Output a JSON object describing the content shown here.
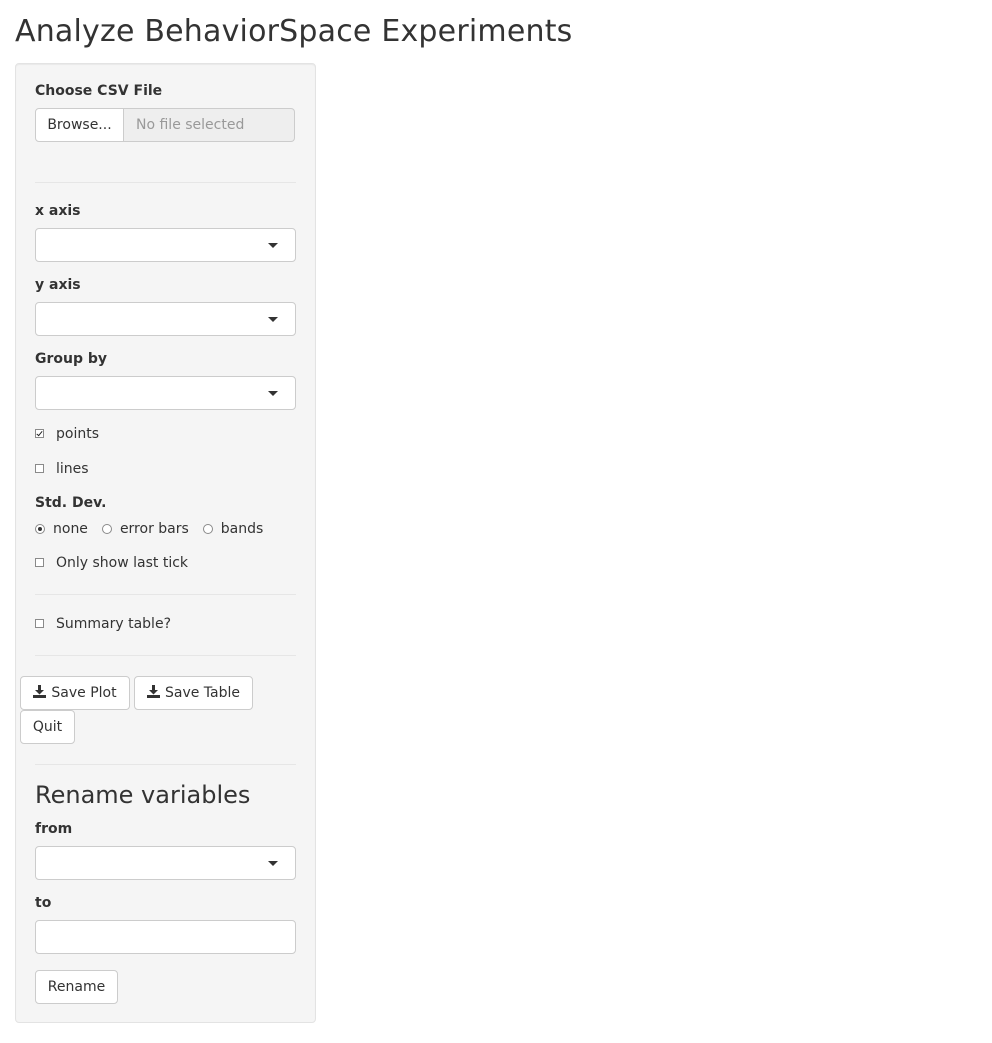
{
  "page": {
    "title": "Analyze BehaviorSpace Experiments"
  },
  "file_input": {
    "label": "Choose CSV File",
    "browse_label": "Browse...",
    "placeholder": "No file selected"
  },
  "plot_controls": {
    "x_axis_label": "x axis",
    "y_axis_label": "y axis",
    "group_by_label": "Group by",
    "points": {
      "label": "points",
      "checked": true
    },
    "lines": {
      "label": "lines",
      "checked": false
    },
    "std_dev": {
      "label": "Std. Dev.",
      "options": [
        {
          "label": "none",
          "selected": true
        },
        {
          "label": "error bars",
          "selected": false
        },
        {
          "label": "bands",
          "selected": false
        }
      ]
    },
    "last_tick": {
      "label": "Only show last tick",
      "checked": false
    },
    "summary_table": {
      "label": "Summary table?",
      "checked": false
    }
  },
  "actions": {
    "save_plot_label": "Save Plot",
    "save_table_label": "Save Table",
    "quit_label": "Quit",
    "icons": {
      "save_plot": "download-icon",
      "save_table": "download-icon"
    }
  },
  "rename": {
    "heading": "Rename variables",
    "from_label": "from",
    "to_label": "to",
    "button_label": "Rename"
  },
  "colors": {
    "sidebar_background": "#f5f5f5",
    "border": "#cccccc",
    "text": "#333333",
    "placeholder_text": "#999999"
  }
}
